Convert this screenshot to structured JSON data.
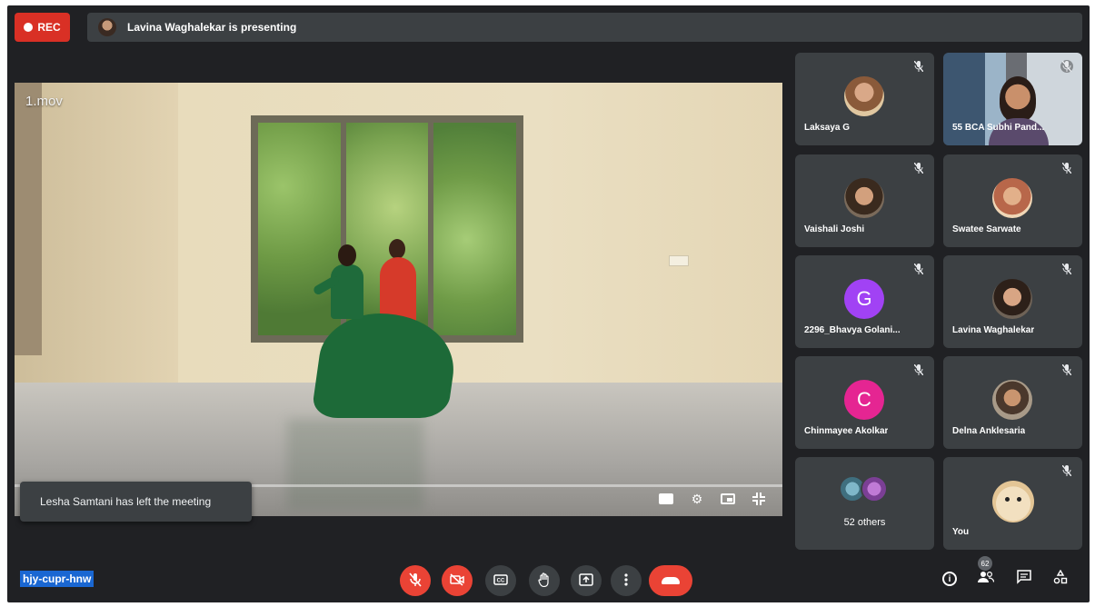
{
  "top_bar": {
    "rec_label": "REC",
    "presenter_text": "Lavina Waghalekar is presenting"
  },
  "presentation": {
    "file_name": "1.mov",
    "notification": "Lesha Samtani has left the meeting",
    "controls": [
      "captions-icon",
      "settings-icon",
      "picture-in-picture-icon",
      "exit-fullscreen-icon"
    ]
  },
  "participants": [
    {
      "name": "Laksaya G",
      "type": "photo",
      "mic": "muted"
    },
    {
      "name": "55 BCA Subhi Pand...",
      "type": "camera",
      "mic": "muted"
    },
    {
      "name": "Vaishali Joshi",
      "type": "photo",
      "mic": "muted"
    },
    {
      "name": "Swatee Sarwate",
      "type": "photo",
      "mic": "muted"
    },
    {
      "name": "2296_Bhavya Golani...",
      "type": "letter",
      "letter": "G",
      "color": "#a142f4",
      "mic": "muted"
    },
    {
      "name": "Lavina Waghalekar",
      "type": "photo",
      "mic": "muted"
    },
    {
      "name": "Chinmayee Akolkar",
      "type": "letter",
      "letter": "C",
      "color": "#e52592",
      "mic": "muted"
    },
    {
      "name": "Delna Anklesaria",
      "type": "photo",
      "mic": "muted"
    },
    {
      "name": "52 others",
      "type": "others"
    },
    {
      "name": "You",
      "type": "photo",
      "mic": "muted"
    }
  ],
  "bottom_bar": {
    "meeting_code": "hjy-cupr-hnw",
    "participant_count": "62",
    "controls": [
      "mic-off-icon",
      "camera-off-icon",
      "captions-icon",
      "raise-hand-icon",
      "present-icon",
      "more-options-icon",
      "end-call-icon"
    ],
    "right_icons": [
      "info-icon",
      "people-icon",
      "chat-icon",
      "activities-icon"
    ]
  },
  "colors": {
    "background": "#202124",
    "tile": "#3c4043",
    "danger": "#ea4335",
    "highlight": "#1a67d2"
  }
}
